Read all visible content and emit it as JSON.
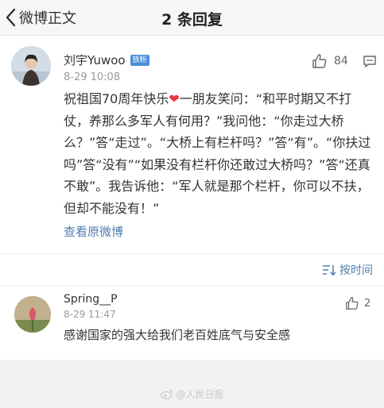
{
  "nav": {
    "back_label": "微博正文",
    "title": "2 条回复"
  },
  "post": {
    "author": "刘宇Yuwoo",
    "badge": "铁粉",
    "time": "8-29 10:08",
    "likes": "84",
    "text_before_heart": "祝祖国70周年快乐",
    "heart": "❤",
    "text_after_heart": "一朋友笑问：“和平时期又不打仗，养那么多军人有何用？”我问他：“你走过大桥么？”答“走过”。“大桥上有栏杆吗？”答“有”。“你扶过吗”答“没有”“如果没有栏杆你还敢过大桥吗？”答“还真不敢”。我告诉他：“军人就是那个栏杆，你可以不扶，但却不能没有！”",
    "view_original": "查看原微博"
  },
  "sort": {
    "label": "按时间"
  },
  "replies": [
    {
      "author": "Spring__P",
      "time": "8-29 11:47",
      "likes": "2",
      "text": "感谢国家的强大给我们老百姓底气与安全感"
    }
  ],
  "watermark": "@人民日报",
  "colors": {
    "link": "#507daf",
    "heart": "#e5393e",
    "page_bg": "#f2f2f2"
  },
  "icons": [
    "back-chevron-icon",
    "thumb-up-icon",
    "comment-icon",
    "sort-icon",
    "weibo-logo-icon"
  ]
}
